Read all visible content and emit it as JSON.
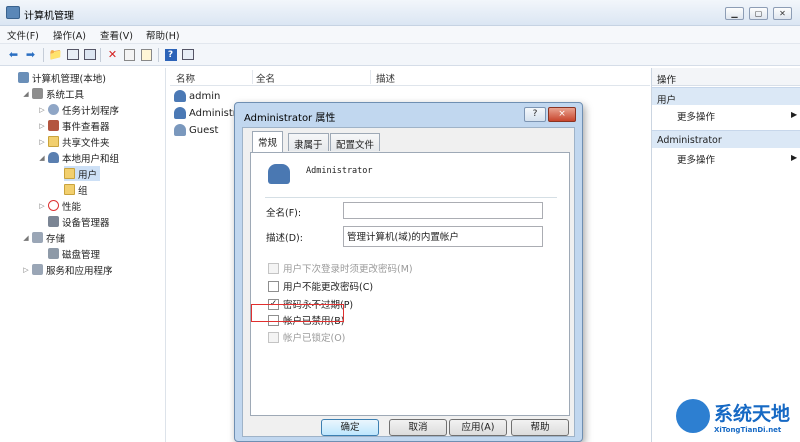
{
  "window": {
    "title": "计算机管理"
  },
  "menu": [
    "文件(F)",
    "操作(A)",
    "查看(V)",
    "帮助(H)"
  ],
  "tree": [
    {
      "label": "计算机管理(本地)"
    },
    {
      "label": "系统工具"
    },
    {
      "label": "任务计划程序"
    },
    {
      "label": "事件查看器"
    },
    {
      "label": "共享文件夹"
    },
    {
      "label": "本地用户和组"
    },
    {
      "label": "用户"
    },
    {
      "label": "组"
    },
    {
      "label": "性能"
    },
    {
      "label": "设备管理器"
    },
    {
      "label": "存储"
    },
    {
      "label": "磁盘管理"
    },
    {
      "label": "服务和应用程序"
    }
  ],
  "list": {
    "columns": [
      "名称",
      "全名",
      "描述"
    ],
    "rows": [
      "admin",
      "Administr",
      "Guest"
    ]
  },
  "actions": {
    "header": "操作",
    "section1": "用户",
    "more1": "更多操作",
    "section2": "Administrator",
    "more2": "更多操作"
  },
  "dialog": {
    "title": "Administrator 属性",
    "tabs": [
      "常规",
      "隶属于",
      "配置文件"
    ],
    "username": "Administrator",
    "fullname_label": "全名(F):",
    "fullname_value": "",
    "desc_label": "描述(D):",
    "desc_value": "管理计算机(域)的内置帐户",
    "checkboxes": [
      {
        "label": "用户下次登录时须更改密码(M)",
        "checked": false,
        "disabled": true
      },
      {
        "label": "用户不能更改密码(C)",
        "checked": false,
        "disabled": false
      },
      {
        "label": "密码永不过期(P)",
        "checked": true,
        "disabled": false
      },
      {
        "label": "帐户已禁用(B)",
        "checked": false,
        "disabled": false
      },
      {
        "label": "帐户已锁定(O)",
        "checked": false,
        "disabled": true
      }
    ],
    "buttons": {
      "ok": "确定",
      "cancel": "取消",
      "apply": "应用(A)",
      "help": "帮助"
    },
    "help_btn": "?",
    "close_btn": "×"
  },
  "watermark": {
    "text": "系统天地",
    "sub": "XiTongTianDi.net"
  }
}
